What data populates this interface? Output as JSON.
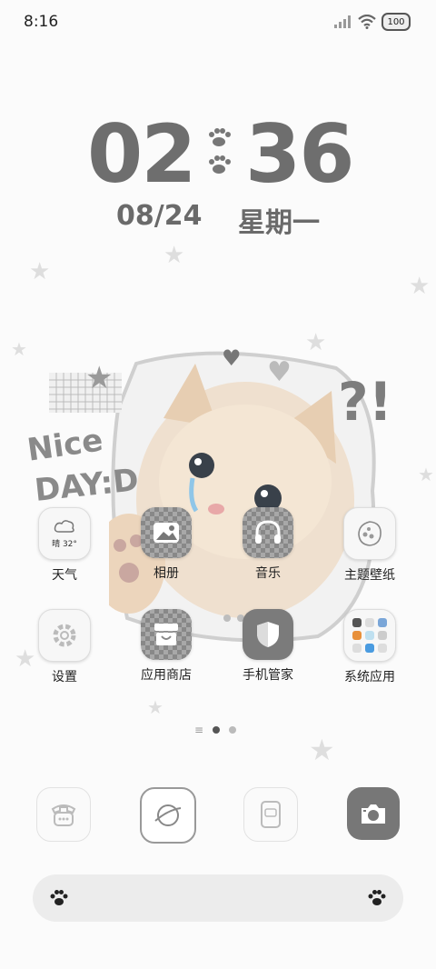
{
  "status_bar": {
    "time": "8:16",
    "battery": "100"
  },
  "clock": {
    "hour": "02",
    "minute": "36",
    "date": "08/24",
    "weekday": "星期一"
  },
  "sticker_text": {
    "line1": "Nice",
    "line2": "DAY:D",
    "marks": "?!"
  },
  "apps": [
    {
      "label": "天气",
      "widget_text": "晴 32°",
      "icon": "weather-icon"
    },
    {
      "label": "相册",
      "icon": "gallery-icon"
    },
    {
      "label": "音乐",
      "icon": "headphones-icon"
    },
    {
      "label": "主题壁纸",
      "icon": "theme-icon"
    },
    {
      "label": "设置",
      "icon": "settings-icon"
    },
    {
      "label": "应用商店",
      "icon": "store-icon"
    },
    {
      "label": "手机管家",
      "icon": "shield-icon"
    },
    {
      "label": "系统应用",
      "icon": "folder-icon"
    }
  ],
  "page_indicator": {
    "pages": 2,
    "active": 1
  },
  "dock": [
    {
      "icon": "phone-icon"
    },
    {
      "icon": "browser-icon"
    },
    {
      "icon": "messages-icon"
    },
    {
      "icon": "camera-icon"
    }
  ],
  "search_bar": {
    "left_icon": "paw-icon",
    "right_icon": "paw-icon"
  }
}
